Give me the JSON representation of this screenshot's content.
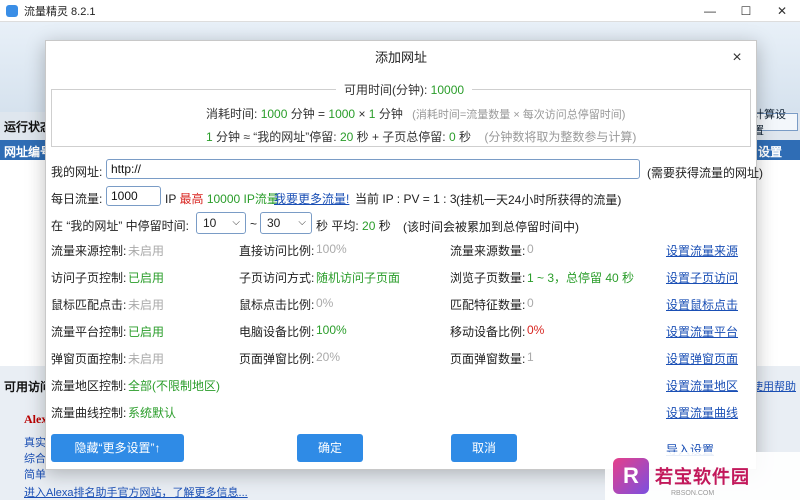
{
  "app": {
    "title": "流量精灵 8.2.1",
    "minimize": "—",
    "maximize": "☐",
    "close": "✕"
  },
  "background": {
    "run_status": "运行状态",
    "url_id": "网址编号",
    "settings_header": "设置",
    "right_button": "计算设置",
    "available_access": "可用访问",
    "alexa": "Alexa",
    "side_line1": "真实",
    "side_line2": "综合",
    "side_line3": "简单",
    "help": "使用帮助",
    "bottom_link": "进入Alexa排名助手官方网站，了解更多信息..."
  },
  "dialog": {
    "title": "添加网址",
    "close": "×",
    "available_time_label": "可用时间(分钟):",
    "available_time_value": "10000",
    "consume_label": "消耗时间:",
    "consume_formula": {
      "p1": "1000",
      "p2": " 分钟 = ",
      "p3": "1000",
      "p4": " × ",
      "p5": "1",
      "p6": " 分钟"
    },
    "consume_note": "(消耗时间=流量数量 × 每次访问总停留时间)",
    "rate_line": {
      "p1": "1",
      "p2": " 分钟 ≈ “我的网址”停留: ",
      "p3": "20",
      "p4": " 秒 + 子页总停留: ",
      "p5": "0",
      "p6": " 秒",
      "note": "(分钟数将取为整数参与计算)"
    },
    "my_url_label": "我的网址:",
    "my_url_value": "http://",
    "my_url_note": "(需要获得流量的网址)",
    "daily_label": "每日流量:",
    "daily_value": "1000",
    "ip_label": "IP",
    "max_label": "最高",
    "max_value": "10000",
    "ip_flow": "IP流量",
    "want_more": "我要更多流量!",
    "current_ippv": "当前 IP : PV = 1 : 3",
    "daily_note": "(挂机一天24小时所获得的流量)",
    "stay_label": "在 “我的网址” 中停留时间:",
    "stay_from": "10",
    "stay_to": "30",
    "tilde": "~",
    "stay_unit": "秒 平均:",
    "stay_avg": "20",
    "stay_avg_unit": "秒",
    "stay_note": "(该时间会被累加到总停留时间中)",
    "grid": [
      [
        {
          "label": "流量来源控制:",
          "value": "未启用",
          "state": "off"
        },
        {
          "label": "直接访问比例:",
          "value": "100%",
          "state": "off"
        },
        {
          "label": "流量来源数量:",
          "value": "0",
          "state": "off"
        },
        {
          "link": "设置流量来源"
        }
      ],
      [
        {
          "label": "访问子页控制:",
          "value": "已启用",
          "state": "on"
        },
        {
          "label": "子页访问方式:",
          "value": "随机访问子页面",
          "state": "on"
        },
        {
          "label": "浏览子页数量:",
          "value": "1 ~ 3，总停留 40 秒",
          "state": "on"
        },
        {
          "link": "设置子页访问"
        }
      ],
      [
        {
          "label": "鼠标匹配点击:",
          "value": "未启用",
          "state": "off"
        },
        {
          "label": "鼠标点击比例:",
          "value": "0%",
          "state": "off"
        },
        {
          "label": "匹配特征数量:",
          "value": "0",
          "state": "off"
        },
        {
          "link": "设置鼠标点击"
        }
      ],
      [
        {
          "label": "流量平台控制:",
          "value": "已启用",
          "state": "on"
        },
        {
          "label": "电脑设备比例:",
          "value": "100%",
          "state": "on"
        },
        {
          "label": "移动设备比例:",
          "value": "0%",
          "state": "red"
        },
        {
          "link": "设置流量平台"
        }
      ],
      [
        {
          "label": "弹窗页面控制:",
          "value": "未启用",
          "state": "off"
        },
        {
          "label": "页面弹窗比例:",
          "value": "20%",
          "state": "off"
        },
        {
          "label": "页面弹窗数量:",
          "value": "1",
          "state": "off"
        },
        {
          "link": "设置弹窗页面"
        }
      ],
      [
        {
          "label": "流量地区控制:",
          "value": "全部(不限制地区)",
          "state": "on"
        },
        {
          "link": "设置流量地区"
        }
      ],
      [
        {
          "label": "流量曲线控制:",
          "value": "系统默认",
          "state": "on"
        },
        {
          "link": "设置流量曲线"
        }
      ]
    ],
    "btn_hide": "隐藏“更多设置”↑",
    "btn_ok": "确定",
    "btn_cancel": "取消",
    "import_link": "导入设置"
  },
  "watermark": {
    "logo": "R",
    "name": "若宝软件园",
    "sub": "RBSON.COM"
  },
  "colors": {
    "accent": "#2f8be6",
    "green": "#2a9d2a",
    "red": "#d8241f",
    "link": "#1a4fb5"
  }
}
